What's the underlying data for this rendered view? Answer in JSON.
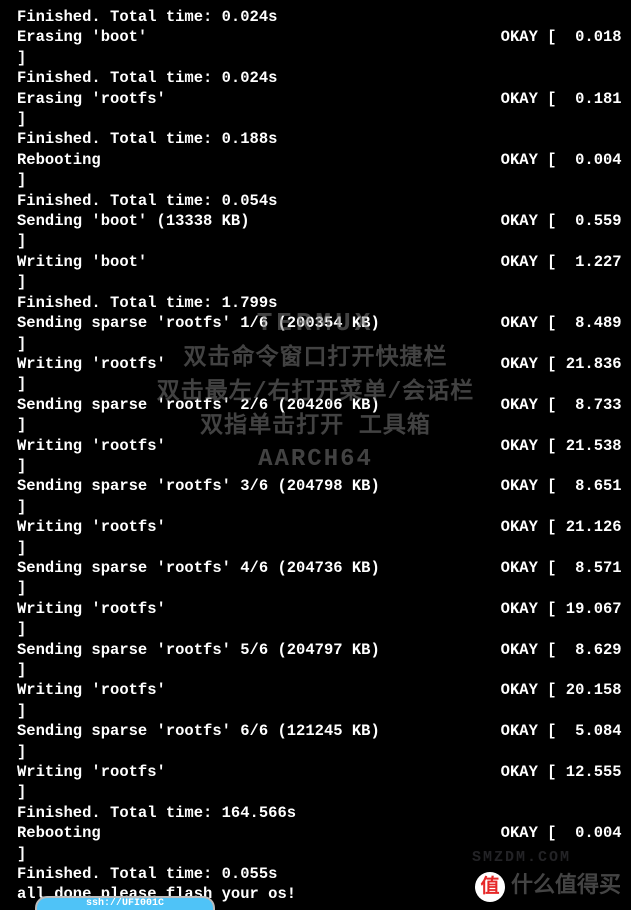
{
  "overlay": {
    "line1": "TERMUX",
    "line2": "双击命令窗口打开快捷栏",
    "line3": "双击最左/右打开菜单/会话栏",
    "line4": "双指单击打开 工具箱",
    "line5": "AARCH64"
  },
  "rows": [
    {
      "left": "Finished. Total time: 0.024s",
      "right": ""
    },
    {
      "left": "Erasing 'boot'",
      "right": "OKAY [  0.018"
    },
    {
      "left": "]",
      "right": ""
    },
    {
      "left": "Finished. Total time: 0.024s",
      "right": ""
    },
    {
      "left": "Erasing 'rootfs'",
      "right": "OKAY [  0.181"
    },
    {
      "left": "]",
      "right": ""
    },
    {
      "left": "Finished. Total time: 0.188s",
      "right": ""
    },
    {
      "left": "Rebooting",
      "right": "OKAY [  0.004"
    },
    {
      "left": "]",
      "right": ""
    },
    {
      "left": "Finished. Total time: 0.054s",
      "right": ""
    },
    {
      "left": "Sending 'boot' (13338 KB)",
      "right": "OKAY [  0.559"
    },
    {
      "left": "]",
      "right": ""
    },
    {
      "left": "Writing 'boot'",
      "right": "OKAY [  1.227"
    },
    {
      "left": "]",
      "right": ""
    },
    {
      "left": "Finished. Total time: 1.799s",
      "right": ""
    },
    {
      "left": "Sending sparse 'rootfs' 1/6 (200354 KB)",
      "right": "OKAY [  8.489"
    },
    {
      "left": "]",
      "right": ""
    },
    {
      "left": "Writing 'rootfs'",
      "right": "OKAY [ 21.836"
    },
    {
      "left": "]",
      "right": ""
    },
    {
      "left": "Sending sparse 'rootfs' 2/6 (204206 KB)",
      "right": "OKAY [  8.733"
    },
    {
      "left": "]",
      "right": ""
    },
    {
      "left": "Writing 'rootfs'",
      "right": "OKAY [ 21.538"
    },
    {
      "left": "]",
      "right": ""
    },
    {
      "left": "Sending sparse 'rootfs' 3/6 (204798 KB)",
      "right": "OKAY [  8.651"
    },
    {
      "left": "]",
      "right": ""
    },
    {
      "left": "Writing 'rootfs'",
      "right": "OKAY [ 21.126"
    },
    {
      "left": "]",
      "right": ""
    },
    {
      "left": "Sending sparse 'rootfs' 4/6 (204736 KB)",
      "right": "OKAY [  8.571"
    },
    {
      "left": "]",
      "right": ""
    },
    {
      "left": "Writing 'rootfs'",
      "right": "OKAY [ 19.067"
    },
    {
      "left": "]",
      "right": ""
    },
    {
      "left": "Sending sparse 'rootfs' 5/6 (204797 KB)",
      "right": "OKAY [  8.629"
    },
    {
      "left": "]",
      "right": ""
    },
    {
      "left": "Writing 'rootfs'",
      "right": "OKAY [ 20.158"
    },
    {
      "left": "]",
      "right": ""
    },
    {
      "left": "Sending sparse 'rootfs' 6/6 (121245 KB)",
      "right": "OKAY [  5.084"
    },
    {
      "left": "]",
      "right": ""
    },
    {
      "left": "Writing 'rootfs'",
      "right": "OKAY [ 12.555"
    },
    {
      "left": "]",
      "right": ""
    },
    {
      "left": "Finished. Total time: 164.566s",
      "right": ""
    },
    {
      "left": "Rebooting",
      "right": "OKAY [  0.004"
    },
    {
      "left": "]",
      "right": ""
    },
    {
      "left": "Finished. Total time: 0.055s",
      "right": ""
    },
    {
      "left": "all done please flash your os!",
      "right": ""
    }
  ],
  "watermark": {
    "badge": "值",
    "text": "什么值得买",
    "text2": "SMZDM.COM"
  },
  "bottom_pill": "ssh://UFI001C"
}
